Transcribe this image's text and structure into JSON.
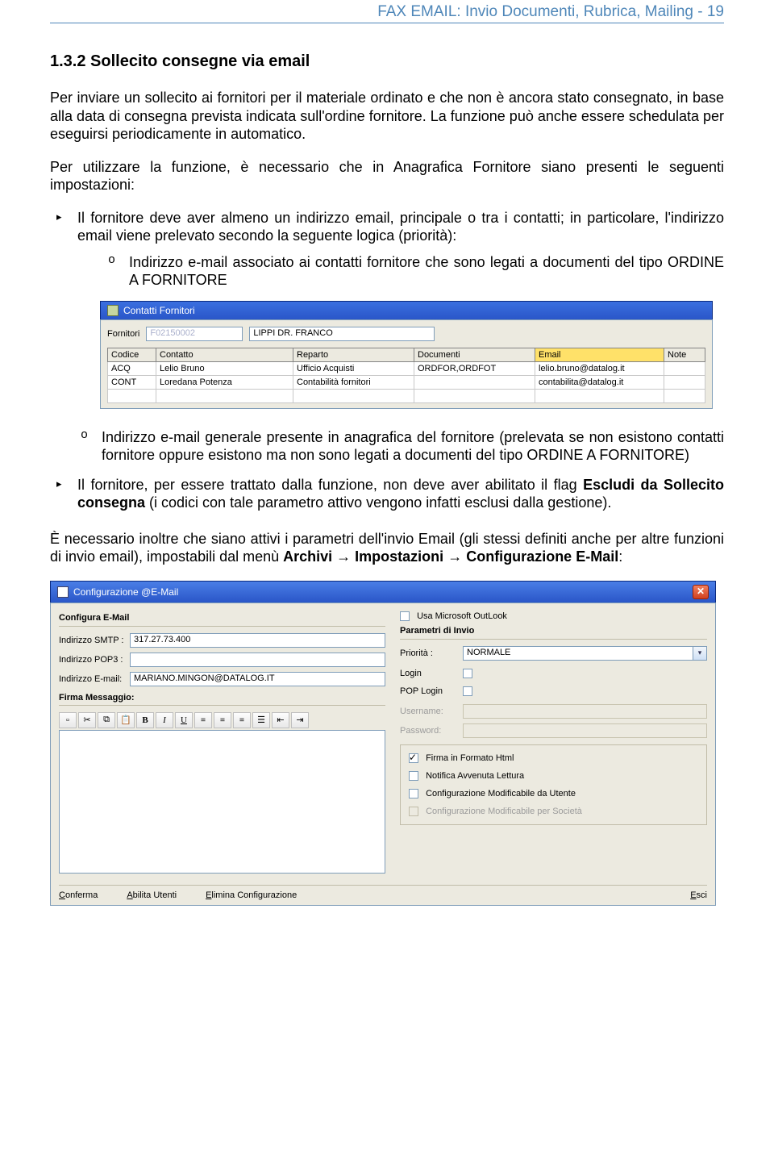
{
  "header": {
    "text": "FAX EMAIL: Invio Documenti, Rubrica, Mailing - 19"
  },
  "section": {
    "title": "1.3.2  Sollecito consegne via email",
    "p1": "Per inviare un sollecito ai fornitori per il materiale ordinato e che non è ancora stato consegnato, in base alla data di consegna prevista indicata sull'ordine fornitore. La funzione può anche essere schedulata per eseguirsi periodicamente in automatico.",
    "p2": "Per utilizzare la funzione, è necessario che in Anagrafica Fornitore siano presenti le seguenti impostazioni:",
    "bullet1_a": "Il fornitore deve aver almeno un indirizzo email, principale o tra i contatti; in particolare, l'indirizzo email viene prelevato secondo la seguente logica (priorità):",
    "sub1_a": "Indirizzo e-mail associato ai contatti fornitore che sono legati a documenti del tipo ORDINE A FORNITORE",
    "sub1_b": "Indirizzo e-mail generale presente in anagrafica del fornitore (prelevata se non esistono contatti fornitore oppure esistono ma non sono legati a documenti del tipo ORDINE A FORNITORE)",
    "bullet2_pre": "Il fornitore, per essere trattato dalla funzione, non deve aver abilitato il flag ",
    "bullet2_b1": "Escludi da Sollecito consegna",
    "bullet2_post": " (i codici con tale parametro attivo vengono infatti esclusi dalla gestione).",
    "p3_pre": "È necessario inoltre che siano attivi i parametri dell'invio Email (gli stessi definiti  anche per altre funzioni di invio email), impostabili dal menù ",
    "p3_m1": "Archivi",
    "p3_arrow": " → ",
    "p3_m2": "Impostazioni",
    "p3_m3": "Configurazione E-Mail",
    "p3_colon": ":"
  },
  "win1": {
    "title": "Contatti Fornitori",
    "lbl_fornitori": "Fornitori",
    "code": "F02150002",
    "name": "LIPPI DR. FRANCO",
    "cols": {
      "c1": "Codice",
      "c2": "Contatto",
      "c3": "Reparto",
      "c4": "Documenti",
      "c5": "Email",
      "c6": "Note"
    },
    "rows": [
      {
        "c1": "ACQ",
        "c2": "Lelio Bruno",
        "c3": "Ufficio Acquisti",
        "c4": "ORDFOR,ORDFOT",
        "c5": "lelio.bruno@datalog.it",
        "c6": ""
      },
      {
        "c1": "CONT",
        "c2": "Loredana Potenza",
        "c3": "Contabilità fornitori",
        "c4": "",
        "c5": "contabilita@datalog.it",
        "c6": ""
      }
    ]
  },
  "win2": {
    "title": "Configurazione @E-Mail",
    "grp_left": "Configura E-Mail",
    "lbl_smtp": "Indirizzo SMTP :",
    "val_smtp": "317.27.73.400",
    "lbl_pop3": "Indirizzo POP3 :",
    "val_pop3": "",
    "lbl_email": "Indirizzo E-mail:",
    "val_email": "MARIANO.MINGON@DATALOG.IT",
    "firma_title": "Firma Messaggio:",
    "chk_outlook": "Usa Microsoft OutLook",
    "grp_right": "Parametri di Invio",
    "lbl_prio": "Priorità :",
    "val_prio": "NORMALE",
    "lbl_login": "Login",
    "lbl_poplogin": "POP Login",
    "lbl_username": "Username:",
    "lbl_password": "Password:",
    "chk_html": "Firma in Formato Html",
    "chk_notif": "Notifica Avvenuta Lettura",
    "chk_conf_utente": "Configurazione Modificabile da Utente",
    "chk_conf_soc": "Configurazione Modificabile per Società",
    "btn_conferma_u": "C",
    "btn_conferma": "onferma",
    "btn_abilita_u": "A",
    "btn_abilita": "bilita Utenti",
    "btn_elimina_u": "E",
    "btn_elimina": "limina Configurazione",
    "btn_esci_u": "E",
    "btn_esci": "sci"
  }
}
